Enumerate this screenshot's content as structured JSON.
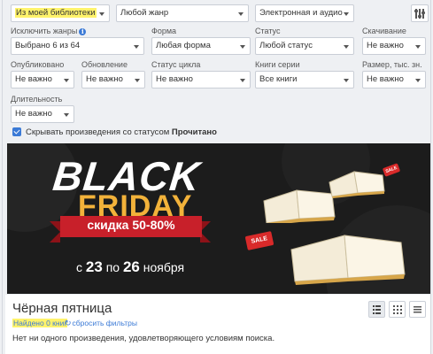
{
  "filters": {
    "library": "Из моей библиотеки",
    "genre": "Любой жанр",
    "format_type": "Электронная и аудио",
    "exclude_genres": {
      "label": "Исключить жанры",
      "value": "Выбрано 6 из 64"
    },
    "form": {
      "label": "Форма",
      "value": "Любая форма"
    },
    "status": {
      "label": "Статус",
      "value": "Любой статус"
    },
    "download": {
      "label": "Скачивание",
      "value": "Не важно"
    },
    "published": {
      "label": "Опубликовано",
      "value": "Не важно"
    },
    "updated": {
      "label": "Обновление",
      "value": "Не важно"
    },
    "cycle_status": {
      "label": "Статус цикла",
      "value": "Не важно"
    },
    "series_books": {
      "label": "Книги серии",
      "value": "Все книги"
    },
    "size": {
      "label": "Размер, тыс. зн.",
      "value": "Не важно"
    },
    "duration": {
      "label": "Длительность",
      "value": "Не важно"
    },
    "hide_read": {
      "label_prefix": "Скрывать произведения со статусом",
      "label_bold": "Прочитано",
      "checked": true
    }
  },
  "banner": {
    "line1": "BLACK",
    "line2": "FRIDAY",
    "discount": "скидка 50-80%",
    "dates_prefix": "с",
    "date_from": "23",
    "dates_mid": "по",
    "date_to": "26",
    "dates_suffix": "ноября",
    "sale_tag": "SALE",
    "colors": {
      "background": "#1c1c1c",
      "friday": "#f2b23a",
      "ribbon": "#c8202a"
    }
  },
  "results": {
    "title": "Чёрная пятница",
    "found": "Найдено 0 книг",
    "reset": "сбросить фильтры",
    "empty_message": "Нет ни одного произведения, удовлетворяющего условиям поиска."
  },
  "colors": {
    "accent": "#3b7ad6",
    "highlight": "#fff36b"
  }
}
